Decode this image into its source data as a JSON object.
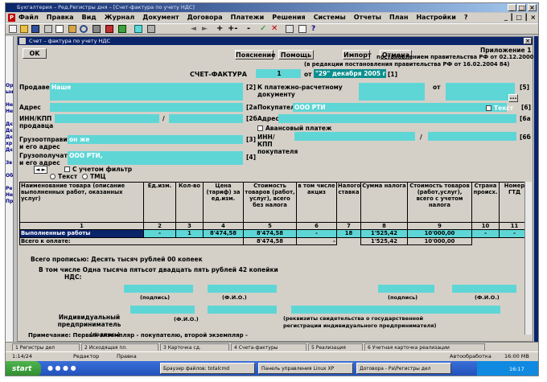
{
  "window": {
    "title": "Бухгалтерия – Ред.Регистры дня – [Счет-фактура по учету НДС]"
  },
  "menu": [
    "Файл",
    "Правка",
    "Вид",
    "Журнал",
    "Документ",
    "Договора",
    "Платежи",
    "Решения",
    "Системы",
    "Отчеты",
    "План",
    "Настройки",
    "?"
  ],
  "child_window": {
    "title": "Счет – фактура по учету НДС"
  },
  "buttons": {
    "ok": "OK",
    "explain": "Пояснение",
    "help": "Помощь",
    "import": "Импорт",
    "cancel": "Отмена"
  },
  "right_notes": {
    "line1": "Приложение 1",
    "line2": "постановлением правительства РФ от 02.12.2000 г",
    "line3": "(в редакции постановления правительства РФ от 16.02.2004  84)"
  },
  "header": {
    "title": "СЧЕТ-ФАКТУРА",
    "number": "1",
    "from": "от",
    "date": "\"29\" декабря 2005 г",
    "code": "[1]"
  },
  "seller": {
    "label": "Продавец",
    "value": "Наше",
    "code": "[2]"
  },
  "address": {
    "label": "Адрес",
    "code": "[2а"
  },
  "inn": {
    "label": "ИНН/КПП продавца",
    "sep": "/",
    "code": "[2б"
  },
  "shipper": {
    "label": "Грузоотправитель и его адрес",
    "value": "он же",
    "code": "[3]"
  },
  "consignee": {
    "label": "Грузополучатель и его адрес",
    "value": "ООО РТИ,",
    "code": "[4]"
  },
  "payment_doc": {
    "label": "К платежно-расчетному документу",
    "from": "от",
    "code": "[5]"
  },
  "buyer": {
    "label": "Покупатель",
    "value": "ООО РТИ",
    "text_flag": "Текст",
    "code": "[6]"
  },
  "buyer_address": {
    "label": "Адрес",
    "code": "[6а"
  },
  "advance": {
    "label": "Авансовый платеж"
  },
  "buyer_inn": {
    "label": "ИНН/КПП покупателя",
    "sep": "/",
    "code": "[6б"
  },
  "options": {
    "vat_filter": "С учетом фильтр",
    "radio_text": "Текст",
    "radio_tmc": "ТМЦ"
  },
  "table": {
    "headers": [
      "Наименование товара (описание выполненных работ, оказанных услуг)",
      "Ед.изм.",
      "Кол-во",
      "Цена (тариф) за ед.изм.",
      "Стоимость товаров (работ, услуг), всего без налога",
      "в том числе акциз",
      "Налоговая ставка",
      "Сумма налога",
      "Стоимость товаров (работ,услуг), всего с учетом налога",
      "Страна происх.",
      "Номер ГТД"
    ],
    "numbers": [
      "1",
      "2",
      "3",
      "4",
      "5",
      "6",
      "7",
      "8",
      "9",
      "10",
      "11"
    ],
    "row": [
      "Выполненные работы",
      "-",
      "1",
      "8'474,58",
      "8'474,58",
      "-",
      "18",
      "1'525,42",
      "10'000,00",
      "-",
      "-"
    ],
    "total_label": "Всего к оплате:",
    "total_cost": "8'474,58",
    "total_excise": "-",
    "total_tax": "1'525,42",
    "total_sum": "10'000,00"
  },
  "words": {
    "line1": "Всего прописью:  Десять тысяч рублей 00 копеек",
    "line2": "В том числе  Одна тысяча пятьсот двадцать пять рублей 42 копейки",
    "line3": "НДС:"
  },
  "signatures": {
    "sign": "(подпись)",
    "fio": "(Ф.И.О.)",
    "entrepreneur": "Индивидуальный предприниматель",
    "cert": "(реквизиты свидетельства о государственной регистрации индивидуального предпринимателя)",
    "note": "Примечание: Первый экземпляр - покупателю, второй экземпляр -"
  },
  "tabs": [
    "1 Регистры дел",
    "2 Исходящая пл.",
    "3 Карточка сд.",
    "4 Счета-фактуры",
    "5 Реализация",
    "6 Учетная карточка реализации"
  ],
  "status": {
    "pos": "1:14/24",
    "mode": "Редактор",
    "edit": "Правка",
    "auto": "Автообработка",
    "time_status": "16:00 MB"
  },
  "taskbar": {
    "start": "start",
    "items": [
      "Браузер файлов: totalcmd",
      "Панель управления Linux XP",
      "Договора - Ра\\Регистры дел"
    ],
    "clock": "16:17"
  }
}
